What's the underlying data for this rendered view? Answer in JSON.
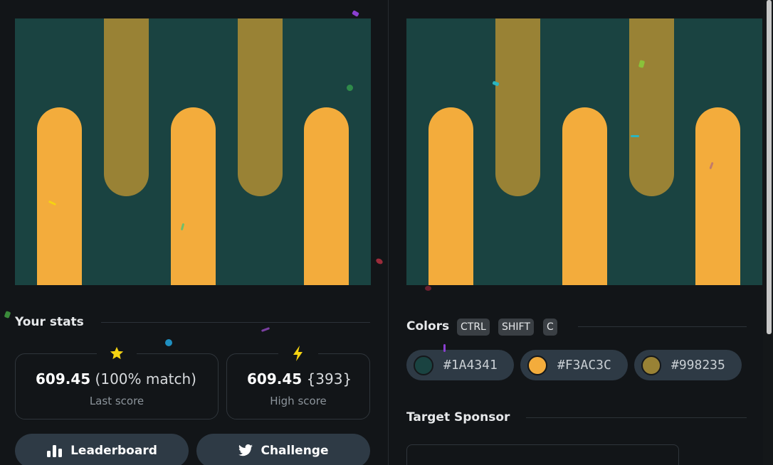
{
  "stats": {
    "title": "Your stats",
    "last": {
      "value": "609.45",
      "extra": "(100% match)",
      "label": "Last score",
      "icon": "star-icon"
    },
    "high": {
      "value": "609.45",
      "extra": "{393}",
      "label": "High score",
      "icon": "lightning-icon"
    }
  },
  "buttons": {
    "leaderboard": "Leaderboard",
    "challenge": "Challenge"
  },
  "colors": {
    "title": "Colors",
    "shortcut": [
      "CTRL",
      "SHIFT",
      "C"
    ],
    "swatches": [
      {
        "hex": "#1A4341"
      },
      {
        "hex": "#F3AC3C"
      },
      {
        "hex": "#998235"
      }
    ]
  },
  "sponsor": {
    "title": "Target Sponsor"
  },
  "palette": {
    "background": "#1A4341",
    "primary": "#F3AC3C",
    "secondary": "#998235"
  }
}
